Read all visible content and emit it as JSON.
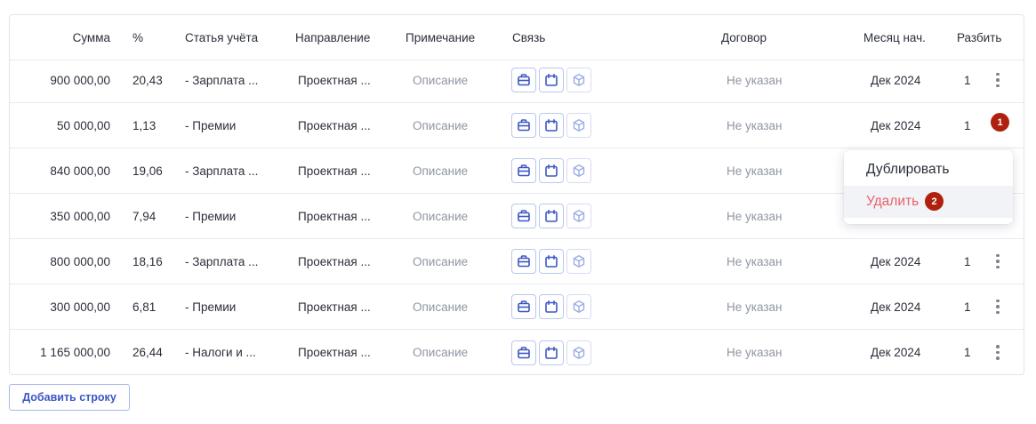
{
  "table": {
    "headers": {
      "sum": "Сумма",
      "percent": "%",
      "article": "Статья учёта",
      "direction": "Направление",
      "note": "Примечание",
      "link": "Связь",
      "contract": "Договор",
      "month": "Месяц нач.",
      "split": "Разбить"
    },
    "rows": [
      {
        "sum": "900 000,00",
        "percent": "20,43",
        "article": "- Зарплата ...",
        "direction": "Проектная ...",
        "note": "Описание",
        "contract": "Не указан",
        "month": "Дек 2024",
        "split": "1"
      },
      {
        "sum": "50 000,00",
        "percent": "1,13",
        "article": "- Премии",
        "direction": "Проектная ...",
        "note": "Описание",
        "contract": "Не указан",
        "month": "Дек 2024",
        "split": "1"
      },
      {
        "sum": "840 000,00",
        "percent": "19,06",
        "article": "- Зарплата ...",
        "direction": "Проектная ...",
        "note": "Описание",
        "contract": "Не указан",
        "month": "",
        "split": ""
      },
      {
        "sum": "350 000,00",
        "percent": "7,94",
        "article": "- Премии",
        "direction": "Проектная ...",
        "note": "Описание",
        "contract": "Не указан",
        "month": "",
        "split": ""
      },
      {
        "sum": "800 000,00",
        "percent": "18,16",
        "article": "- Зарплата ...",
        "direction": "Проектная ...",
        "note": "Описание",
        "contract": "Не указан",
        "month": "Дек 2024",
        "split": "1"
      },
      {
        "sum": "300 000,00",
        "percent": "6,81",
        "article": "- Премии",
        "direction": "Проектная ...",
        "note": "Описание",
        "contract": "Не указан",
        "month": "Дек 2024",
        "split": "1"
      },
      {
        "sum": "1 165 000,00",
        "percent": "26,44",
        "article": "- Налоги и ...",
        "direction": "Проектная ...",
        "note": "Описание",
        "contract": "Не указан",
        "month": "Дек 2024",
        "split": "1"
      }
    ]
  },
  "link_icons": [
    "briefcase-icon",
    "calendar-icon",
    "cube-icon"
  ],
  "dropdown": {
    "duplicate_label": "Дублировать",
    "delete_label": "Удалить"
  },
  "badges": {
    "first": "1",
    "second": "2"
  },
  "add_row_label": "Добавить строку",
  "colors": {
    "accent": "#3b56c4",
    "danger_text": "#e8616b",
    "badge": "#b1200f",
    "muted_text": "#8f96a3"
  }
}
